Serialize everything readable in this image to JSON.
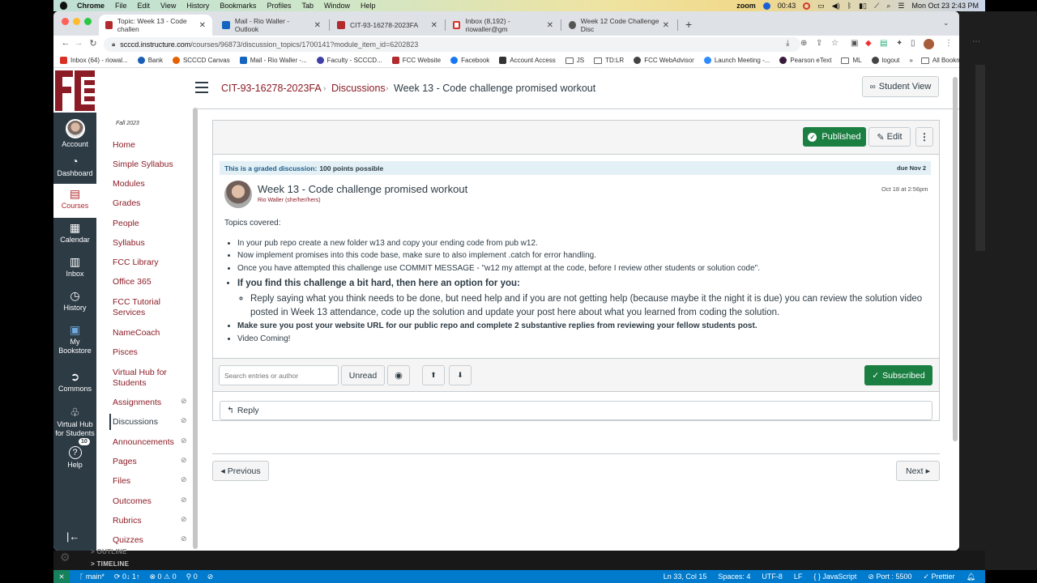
{
  "macos": {
    "menu": [
      "Chrome",
      "File",
      "Edit",
      "View",
      "History",
      "Bookmarks",
      "Profiles",
      "Tab",
      "Window",
      "Help"
    ],
    "zoom_label": "zoom",
    "timer": "00:43",
    "clock": "Mon Oct 23  2:43 PM"
  },
  "browser": {
    "tabs": [
      {
        "title": "Topic: Week 13 - Code challen",
        "active": true,
        "color": "#b12a2e"
      },
      {
        "title": "Mail - Rio Waller - Outlook",
        "active": false,
        "color": "#1565c0"
      },
      {
        "title": "CIT-93-16278-2023FA",
        "active": false,
        "color": "#b12a2e"
      },
      {
        "title": "Inbox (8,192) - riowaller@gm",
        "active": false,
        "color": "#d93025"
      },
      {
        "title": "Week 12 Code Challenge Disc",
        "active": false,
        "color": "#555555"
      }
    ],
    "new_tab": "+",
    "url_host": "sscccd.instructure.com",
    "url_host_display": "scccd.instructure.com",
    "url_path": "/courses/96873/discussion_topics/1700141?module_item_id=6202823",
    "bookmarks": [
      {
        "label": "Inbox (64) - riowal...",
        "icon": "gmail-icon",
        "color": "#d93025"
      },
      {
        "label": "Bank",
        "icon": "bank-icon",
        "color": "#1a5fb4"
      },
      {
        "label": "SCCCD Canvas",
        "icon": "canvas-icon",
        "color": "#e66000"
      },
      {
        "label": "Mail - Rio Waller -...",
        "icon": "outlook-icon",
        "color": "#1565c0"
      },
      {
        "label": "Faculty - SCCCD...",
        "icon": "faculty-icon",
        "color": "#3f3fa8"
      },
      {
        "label": "FCC Website",
        "icon": "fcc-icon",
        "color": "#b12a2e"
      },
      {
        "label": "Facebook",
        "icon": "facebook-icon",
        "color": "#1877f2"
      },
      {
        "label": "Account Access",
        "icon": "account-icon",
        "color": "#333333"
      },
      {
        "label": "JS",
        "icon": "folder-icon",
        "color": ""
      },
      {
        "label": "TD:LR",
        "icon": "folder-icon",
        "color": ""
      },
      {
        "label": "FCC WebAdvisor",
        "icon": "globe-icon",
        "color": "#444444"
      },
      {
        "label": "Launch Meeting -...",
        "icon": "zoom-icon",
        "color": "#2d8cff"
      },
      {
        "label": "Pearson eText",
        "icon": "pearson-icon",
        "color": "#3a1a3a"
      },
      {
        "label": "ML",
        "icon": "folder-icon",
        "color": ""
      },
      {
        "label": "logout",
        "icon": "globe-icon",
        "color": "#444444"
      }
    ],
    "more_bookmarks": "»",
    "all_bookmarks": "All Bookmarks"
  },
  "canvas": {
    "global_nav": [
      {
        "label": "Account",
        "icon": "account-avatar-icon"
      },
      {
        "label": "Dashboard",
        "icon": "dashboard-icon",
        "glyph": "◔"
      },
      {
        "label": "Courses",
        "icon": "courses-icon",
        "glyph": "▤",
        "active": true
      },
      {
        "label": "Calendar",
        "icon": "calendar-icon",
        "glyph": "▦"
      },
      {
        "label": "Inbox",
        "icon": "inbox-icon",
        "glyph": "▥"
      },
      {
        "label": "History",
        "icon": "history-icon",
        "glyph": "◷"
      },
      {
        "label": "My Bookstore",
        "icon": "bookstore-icon",
        "glyph": "▣"
      },
      {
        "label": "Commons",
        "icon": "commons-icon",
        "glyph": "➲"
      },
      {
        "label": "Virtual Hub for Students",
        "icon": "virtual-hub-icon",
        "glyph": "♧"
      },
      {
        "label": "Help",
        "icon": "help-icon",
        "glyph": "?",
        "badge": "10"
      }
    ],
    "collapse_glyph": "|←",
    "breadcrumb": {
      "course": "CIT-93-16278-2023FA",
      "section": "Discussions",
      "current": "Week 13 - Code challenge promised workout",
      "separator": "›"
    },
    "student_view": "Student View",
    "course_nav": {
      "term": "Fall 2023",
      "items": [
        {
          "label": "Home",
          "hidden": false
        },
        {
          "label": "Simple Syllabus",
          "hidden": false
        },
        {
          "label": "Modules",
          "hidden": false
        },
        {
          "label": "Grades",
          "hidden": false
        },
        {
          "label": "People",
          "hidden": false
        },
        {
          "label": "Syllabus",
          "hidden": false
        },
        {
          "label": "FCC Library",
          "hidden": false
        },
        {
          "label": "Office 365",
          "hidden": false
        },
        {
          "label": "FCC Tutorial Services",
          "hidden": false
        },
        {
          "label": "NameCoach",
          "hidden": false
        },
        {
          "label": "Pisces",
          "hidden": false
        },
        {
          "label": "Virtual Hub for Students",
          "hidden": false
        },
        {
          "label": "Assignments",
          "hidden": true
        },
        {
          "label": "Discussions",
          "hidden": true,
          "active": true
        },
        {
          "label": "Announcements",
          "hidden": true
        },
        {
          "label": "Pages",
          "hidden": true
        },
        {
          "label": "Files",
          "hidden": true
        },
        {
          "label": "Outcomes",
          "hidden": true
        },
        {
          "label": "Rubrics",
          "hidden": true
        },
        {
          "label": "Quizzes",
          "hidden": true
        }
      ]
    },
    "topic": {
      "published_label": "Published",
      "edit_label": "Edit",
      "more_label": "⋮",
      "graded_label": "This is a graded discussion:",
      "points": "100 points possible",
      "due": "due Nov 2",
      "title": "Week 13 - Code challenge promised workout",
      "author": "Rio Waller (she/her/hers)",
      "posted": "Oct 18 at 2:56pm",
      "intro": "Topics covered:",
      "bullets": [
        "In your pub repo create a new folder w13 and copy your ending code from pub w12.",
        "Now implement promises into this code base, make sure to also implement .catch for error handling.",
        "Once you have attempted this challenge use COMMIT MESSAGE - \"w12 my attempt at the code, before I review other students or solution code\"."
      ],
      "option_heading": "If you find this challenge a bit hard, then here an option for you:",
      "option_sub": "Reply saying what you think needs to be done, but need help and if you are not getting help (because maybe it the night it is due) you can review the solution video posted in Week 13 attendance, code up the solution and update your post here about what you learned from coding the solution.",
      "requirement": "Make sure you post your website URL for our public repo and complete 2 substantive replies from reviewing your fellow students post.",
      "video_note": "Video Coming!"
    },
    "filter": {
      "search_placeholder": "Search entries or author",
      "unread_label": "Unread",
      "subscribed_label": "Subscribed"
    },
    "reply_label": "Reply",
    "previous_label": "Previous",
    "next_label": "Next"
  },
  "vscode": {
    "outline_label": "OUTLINE",
    "timeline_label": "TIMELINE",
    "status_left": [
      "main*",
      "0↓ 1↑",
      "⊗ 0 ⚠ 0",
      "0"
    ],
    "status_right": [
      "Ln 33, Col 15",
      "Spaces: 4",
      "UTF-8",
      "LF",
      "{ } JavaScript",
      "⊘ Port : 5500",
      "✓ Prettier"
    ]
  }
}
